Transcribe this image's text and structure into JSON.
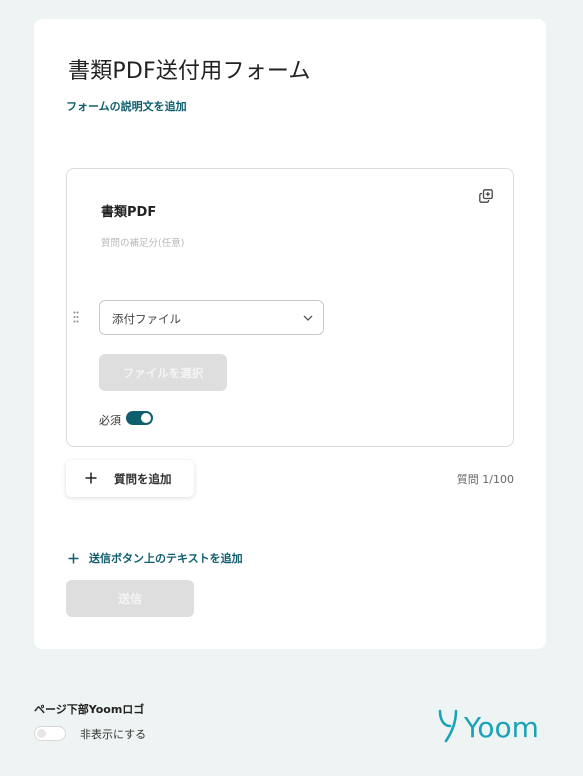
{
  "form": {
    "title": "書類PDF送付用フォーム",
    "add_description": "フォームの説明文を追加"
  },
  "question": {
    "title": "書類PDF",
    "supplement_placeholder": "質問の補足分(任意)",
    "type_selected": "添付ファイル",
    "file_button": "ファイルを選択",
    "required_label": "必須",
    "required": true
  },
  "actions": {
    "add_question": "質問を追加",
    "question_count": "質問 1/100",
    "add_submit_text": "送信ボタン上のテキストを追加",
    "submit": "送信"
  },
  "footer": {
    "logo_setting_label": "ページ下部Yoomロゴ",
    "hide_label": "非表示にする",
    "hide_logo": false,
    "logo_text": "Yoom"
  },
  "colors": {
    "accent": "#0f5e6e",
    "logo": "#1aa3b8",
    "background": "#eef4f3",
    "disabled_button": "#dedede"
  },
  "icons": {
    "copy": "copy-icon",
    "drag": "drag-handle-icon",
    "chevron": "chevron-down-icon",
    "plus": "plus-icon"
  }
}
